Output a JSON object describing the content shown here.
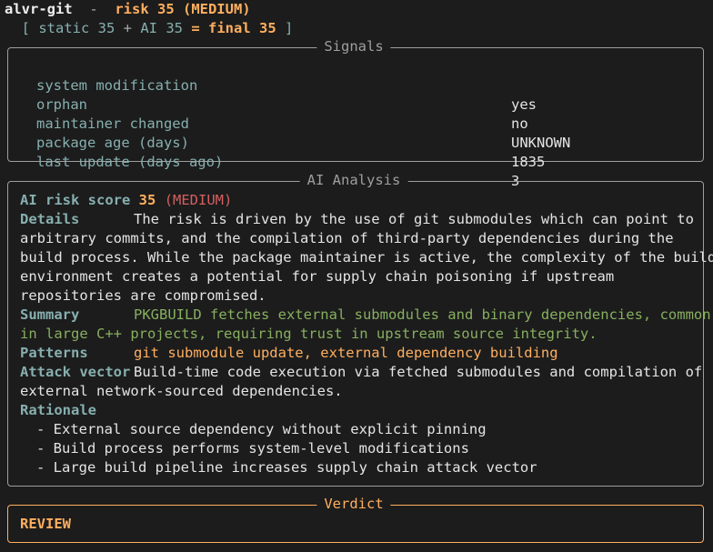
{
  "header": {
    "package": "alvr-git",
    "separator": "  -  ",
    "risk_text": "risk 35 (MEDIUM)",
    "open_bracket": "  [ ",
    "static_label": "static 35",
    "plus": " + ",
    "ai_label": "AI 35",
    "final_label": " = final 35",
    "close_bracket": " ]"
  },
  "signals": {
    "title": "Signals",
    "rows": [
      {
        "label": "system modification",
        "value": "yes"
      },
      {
        "label": "orphan",
        "value": "no"
      },
      {
        "label": "maintainer changed",
        "value": "UNKNOWN"
      },
      {
        "label": "package age (days)",
        "value": "1835"
      },
      {
        "label": "last update (days ago)",
        "value": "3"
      }
    ]
  },
  "ai_analysis": {
    "title": "AI Analysis",
    "score_label": "AI risk score",
    "score_value": "35",
    "score_level": "(MEDIUM)",
    "details_label": "Details",
    "details_lines": [
      "The risk is driven by the use of git submodules which can point to",
      "arbitrary commits, and the compilation of third-party dependencies during the",
      "build process. While the package maintainer is active, the complexity of the build",
      "environment creates a potential for supply chain poisoning if upstream",
      "repositories are compromised."
    ],
    "summary_label": "Summary",
    "summary_lines": [
      "PKGBUILD fetches external submodules and binary dependencies, common",
      "in large C++ projects, requiring trust in upstream source integrity."
    ],
    "patterns_label": "Patterns",
    "patterns_value": "git submodule update, external dependency building",
    "attack_label": "Attack vector",
    "attack_lines": [
      "Build-time code execution via fetched submodules and compilation of",
      "external network-sourced dependencies."
    ],
    "rationale_label": "Rationale",
    "rationale_items": [
      "- External source dependency without explicit pinning",
      "- Build process performs system-level modifications",
      "- Large build pipeline increases supply chain attack vector"
    ]
  },
  "verdict": {
    "title": "Verdict",
    "value": "REVIEW"
  },
  "colors": {
    "background": "#1c1c1c",
    "accent_orange": "#ffaf5f",
    "label_teal": "#87afaf",
    "medium_red": "#d75f5f",
    "summary_green": "#87af5f"
  }
}
